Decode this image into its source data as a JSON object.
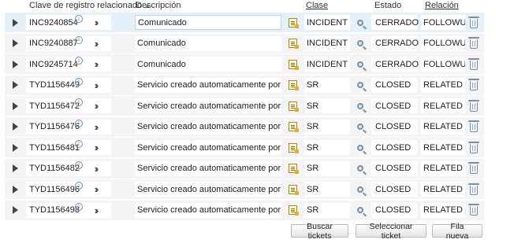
{
  "headers": {
    "key": "Clave de registro relacionado",
    "sort_indicator": "▲",
    "description": "Descripción",
    "class": "Clase",
    "status": "Estado",
    "relation": "Relación"
  },
  "icons": {
    "expand": "triangle-right",
    "info": "info-circle",
    "link": "double-chevron-right",
    "detail": "notepad",
    "lookup": "magnifier",
    "delete": "trash-can"
  },
  "rows": [
    {
      "key": "INC9240854",
      "desc": "Comunicado",
      "cls": "INCIDENT",
      "status": "CERRADO",
      "rel": "FOLLOWUP"
    },
    {
      "key": "INC9240887",
      "desc": "Comunicado",
      "cls": "INCIDENT",
      "status": "CERRADO",
      "rel": "FOLLOWUP"
    },
    {
      "key": "INC9245714",
      "desc": "Comunicado",
      "cls": "INCIDENT",
      "status": "CERRADO",
      "rel": "FOLLOWUP"
    },
    {
      "key": "TYD1156449",
      "desc": "Servicio creado automaticamente por inciden",
      "cls": "SR",
      "status": "CLOSED",
      "rel": "RELATED"
    },
    {
      "key": "TYD1156472",
      "desc": "Servicio creado automaticamente por inciden",
      "cls": "SR",
      "status": "CLOSED",
      "rel": "RELATED"
    },
    {
      "key": "TYD1156476",
      "desc": "Servicio creado automaticamente por inciden",
      "cls": "SR",
      "status": "CLOSED",
      "rel": "RELATED"
    },
    {
      "key": "TYD1156481",
      "desc": "Servicio creado automaticamente por inciden",
      "cls": "SR",
      "status": "CLOSED",
      "rel": "RELATED"
    },
    {
      "key": "TYD1156482",
      "desc": "Servicio creado automaticamente por inciden",
      "cls": "SR",
      "status": "CLOSED",
      "rel": "RELATED"
    },
    {
      "key": "TYD1156496",
      "desc": "Servicio creado automaticamente por inciden",
      "cls": "SR",
      "status": "CLOSED",
      "rel": "RELATED"
    },
    {
      "key": "TYD1156498",
      "desc": "Servicio creado automaticamente por inciden",
      "cls": "SR",
      "status": "CLOSED",
      "rel": "RELATED"
    }
  ],
  "buttons": {
    "search": "Buscar tickets",
    "select": "Seleccionar ticket",
    "new_row": "Fila nueva"
  },
  "colors": {
    "selected_row": "#e5f1fa",
    "row": "#f4f4f4"
  }
}
